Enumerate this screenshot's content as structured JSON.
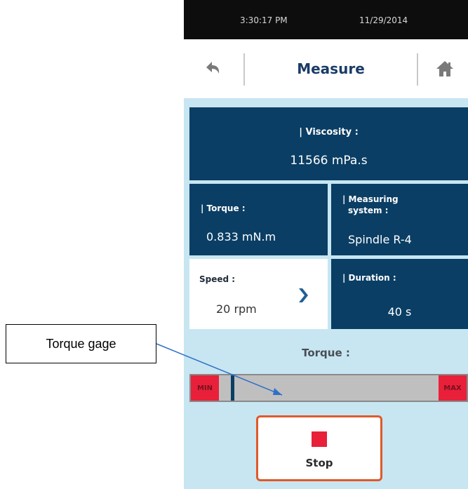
{
  "status_bar": {
    "time": "3:30:17 PM",
    "date": "11/29/2014"
  },
  "header": {
    "title": "Measure",
    "back_icon": "back-arrow-icon",
    "home_icon": "home-icon"
  },
  "viscosity": {
    "label": "| Viscosity :",
    "value": "11566 mPa.s"
  },
  "torque": {
    "label": "| Torque :",
    "value": "0.833 mN.m"
  },
  "measuring_system": {
    "label_line1": "| Measuring",
    "label_line2": "system :",
    "value": "Spindle R-4"
  },
  "speed": {
    "label": "Speed :",
    "value": "20 rpm",
    "chevron_icon": "chevron-right-icon"
  },
  "duration": {
    "label": "| Duration :",
    "value": "40 s"
  },
  "torque_gauge": {
    "heading": "Torque :",
    "min_label": "MIN",
    "max_label": "MAX",
    "level_fraction": 0.04
  },
  "stop_button": {
    "label": "Stop"
  },
  "annotation": {
    "callout_text": "Torque gage"
  },
  "colors": {
    "panel": "#0a3e64",
    "screen_background": "#c7e6f2",
    "accent_red": "#e8203a",
    "stop_border": "#e05a2a",
    "callout_line": "#2f6fc8"
  }
}
